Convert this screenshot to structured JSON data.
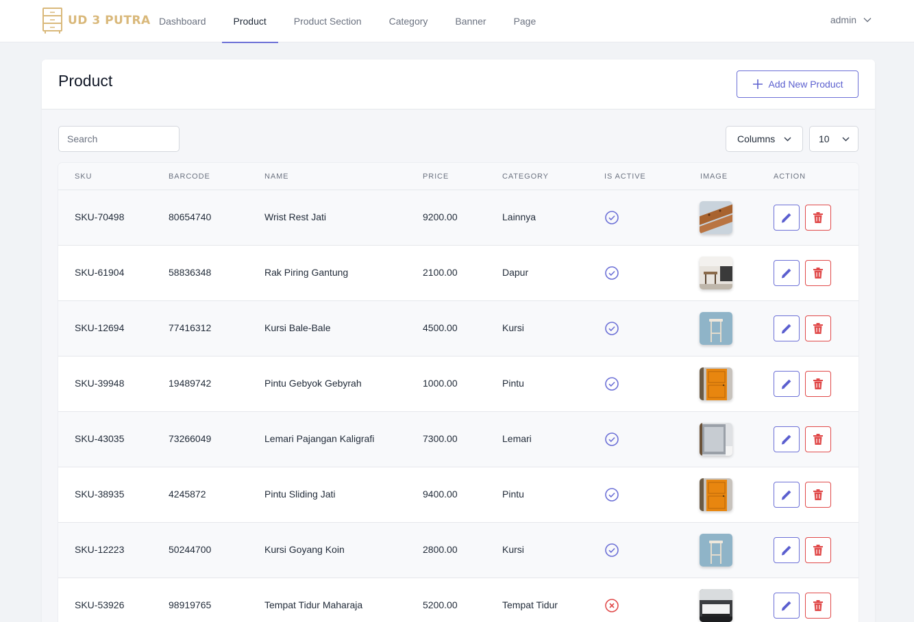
{
  "brand": {
    "name": "UD 3 PUTRA",
    "color": "#d9b87a"
  },
  "nav": {
    "items": [
      {
        "label": "Dashboard",
        "active": false
      },
      {
        "label": "Product",
        "active": true
      },
      {
        "label": "Product Section",
        "active": false
      },
      {
        "label": "Category",
        "active": false
      },
      {
        "label": "Banner",
        "active": false
      },
      {
        "label": "Page",
        "active": false
      }
    ],
    "user": "admin"
  },
  "page": {
    "title": "Product",
    "add_button": "Add New Product",
    "search_placeholder": "Search",
    "columns_button": "Columns",
    "per_page": "10"
  },
  "table": {
    "headers": [
      "SKU",
      "BARCODE",
      "NAME",
      "PRICE",
      "CATEGORY",
      "IS ACTIVE",
      "IMAGE",
      "ACTION"
    ],
    "rows": [
      {
        "sku": "SKU-70498",
        "barcode": "80654740",
        "name": "Wrist Rest Jati",
        "price": "9200.00",
        "category": "Lainnya",
        "active": true,
        "image": "wood-plank-icon"
      },
      {
        "sku": "SKU-61904",
        "barcode": "58836348",
        "name": "Rak Piring Gantung",
        "price": "2100.00",
        "category": "Dapur",
        "active": true,
        "image": "kitchen-icon"
      },
      {
        "sku": "SKU-12694",
        "barcode": "77416312",
        "name": "Kursi Bale-Bale",
        "price": "4500.00",
        "category": "Kursi",
        "active": true,
        "image": "stool-icon"
      },
      {
        "sku": "SKU-39948",
        "barcode": "19489742",
        "name": "Pintu Gebyok Gebyrah",
        "price": "1000.00",
        "category": "Pintu",
        "active": true,
        "image": "door-icon"
      },
      {
        "sku": "SKU-43035",
        "barcode": "73266049",
        "name": "Lemari Pajangan Kaligrafi",
        "price": "7300.00",
        "category": "Lemari",
        "active": true,
        "image": "wardrobe-icon"
      },
      {
        "sku": "SKU-38935",
        "barcode": "4245872",
        "name": "Pintu Sliding Jati",
        "price": "9400.00",
        "category": "Pintu",
        "active": true,
        "image": "door-icon"
      },
      {
        "sku": "SKU-12223",
        "barcode": "50244700",
        "name": "Kursi Goyang Koin",
        "price": "2800.00",
        "category": "Kursi",
        "active": true,
        "image": "stool-icon"
      },
      {
        "sku": "SKU-53926",
        "barcode": "98919765",
        "name": "Tempat Tidur Maharaja",
        "price": "5200.00",
        "category": "Tempat Tidur",
        "active": false,
        "image": "bedroom-icon"
      }
    ]
  },
  "colors": {
    "accent": "#6b6fd6",
    "danger": "#e04848",
    "active": "#6b6fd6",
    "inactive": "#e04848"
  }
}
